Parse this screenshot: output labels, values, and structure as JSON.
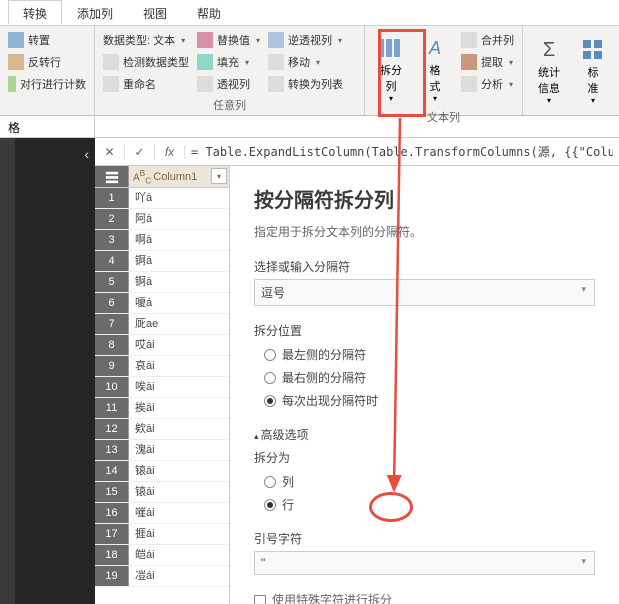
{
  "tabs": [
    "转换",
    "添加列",
    "视图",
    "帮助"
  ],
  "ribbon": {
    "transpose": "转置",
    "reverse": "反转行",
    "countRows": "对行进行计数",
    "dataType": "数据类型: 文本",
    "detectType": "检测数据类型",
    "rename": "重命名",
    "replaceValues": "替换值",
    "fill": "填充",
    "pivot": "透视列",
    "unpivot": "逆透视列",
    "move": "移动",
    "toList": "转换为列表",
    "splitColumn": "拆分\n列",
    "format": "格\n式",
    "merge": "合并列",
    "extract": "提取",
    "analyze": "分析",
    "stats": "统计\n信息",
    "standard": "标\n准",
    "groupAny": "任意列",
    "groupText": "文本列"
  },
  "subtab": "格",
  "formula": "= Table.ExpandListColumn(Table.TransformColumns(源, {{\"Column",
  "column": {
    "header": "Column1"
  },
  "rows": [
    "吖ā",
    "阿ā",
    "啊ā",
    "锕ā",
    "锕ā",
    "嗄á",
    "厑ae",
    "哎āi",
    "哀āi",
    "唉āi",
    "挨āi",
    "欸āi",
    "溾āi",
    "锿āi",
    "锿āi",
    "嘊ái",
    "捱ái",
    "皑ái",
    "凒ái"
  ],
  "dialog": {
    "title": "按分隔符拆分列",
    "desc": "指定用于拆分文本列的分隔符。",
    "selectLabel": "选择或输入分隔符",
    "delimiter": "逗号",
    "posLabel": "拆分位置",
    "posLeft": "最左侧的分隔符",
    "posRight": "最右侧的分隔符",
    "posEach": "每次出现分隔符时",
    "advanced": "高级选项",
    "splitToLabel": "拆分为",
    "splitCol": "列",
    "splitRow": "行",
    "quoteLabel": "引号字符",
    "quoteVal": "\"",
    "useSpecial": "使用特殊字符进行拆分"
  }
}
